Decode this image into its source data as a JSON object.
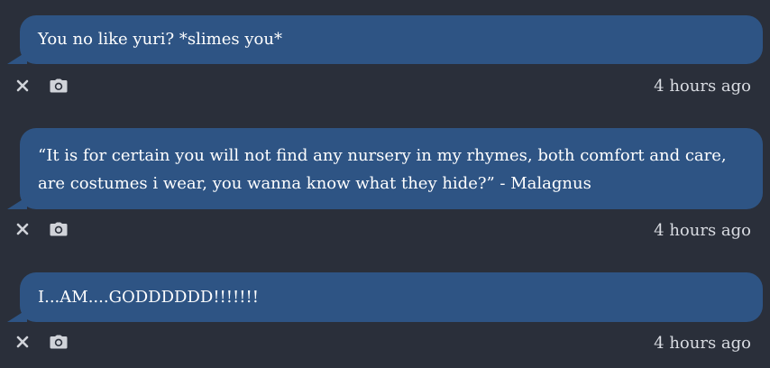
{
  "messages": [
    {
      "text": "You no like yuri? *slimes you*",
      "time": "4 hours ago"
    },
    {
      "text": "“It is for certain you will not find any nursery in my rhymes, both comfort and care, are costumes i wear, you wanna know what they hide?” - Malagnus",
      "time": "4 hours ago"
    },
    {
      "text": "I...AM....GODDDDDD!!!!!!!",
      "time": "4 hours ago"
    }
  ],
  "icons": {
    "delete": "close-icon",
    "screenshot": "camera-icon"
  },
  "colors": {
    "background": "#2a2f3a",
    "bubble": "#2e5484",
    "text": "#ffffff",
    "timestamp": "#d9dce2",
    "icon": "#d0d3d9"
  }
}
